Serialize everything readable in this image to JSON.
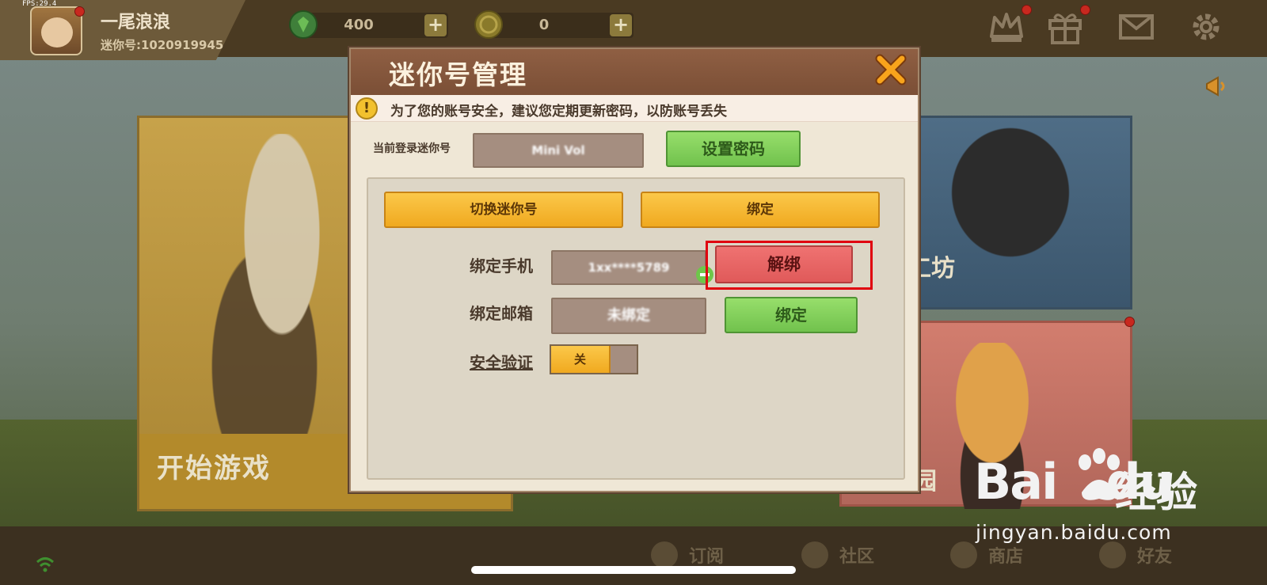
{
  "status": {
    "fps": "FPS:29.4"
  },
  "profile": {
    "nickname": "一尾浪浪",
    "mini_id": "迷你号:1020919945"
  },
  "currency": [
    {
      "amount": "400",
      "plus": "+",
      "icon": "gem-icon"
    },
    {
      "amount": "0",
      "plus": "+",
      "icon": "coin-icon"
    }
  ],
  "top_icons": [
    "crown-icon",
    "gift-icon",
    "mail-icon",
    "gear-icon"
  ],
  "background_cards": {
    "start_game": "开始游戏",
    "workshop_partial": "工坊",
    "home_partial": "我的家园"
  },
  "bottom_nav": [
    {
      "label": "订阅",
      "icon": "star-icon"
    },
    {
      "label": "社区",
      "icon": "community-icon"
    },
    {
      "label": "商店",
      "icon": "cart-icon"
    },
    {
      "label": "好友",
      "icon": "friends-icon"
    }
  ],
  "dialog": {
    "title": "迷你号管理",
    "notice": "为了您的账号安全，建议您定期更新密码，以防账号丢失",
    "current_label": "当前登录迷你号",
    "current_value": "Mini Vol",
    "set_password_button": "设置密码",
    "switch_button": "切换迷你号",
    "bind_tab_button": "绑定",
    "phone_label": "绑定手机",
    "phone_value": "1xx****5789",
    "unbind_button": "解绑",
    "email_label": "绑定邮箱",
    "email_value": "未绑定",
    "email_bind_button": "绑定",
    "security_label": "安全验证",
    "security_toggle": "关"
  },
  "watermark": {
    "logo_left": "Bai",
    "logo_right": "du",
    "cn": "经验",
    "url": "jingyan.baidu.com"
  },
  "colors": {
    "highlight": "#e0000f",
    "green": "#71c24d",
    "yellow": "#f0a91f",
    "red": "#e05a5a",
    "header": "#7b4f36"
  }
}
